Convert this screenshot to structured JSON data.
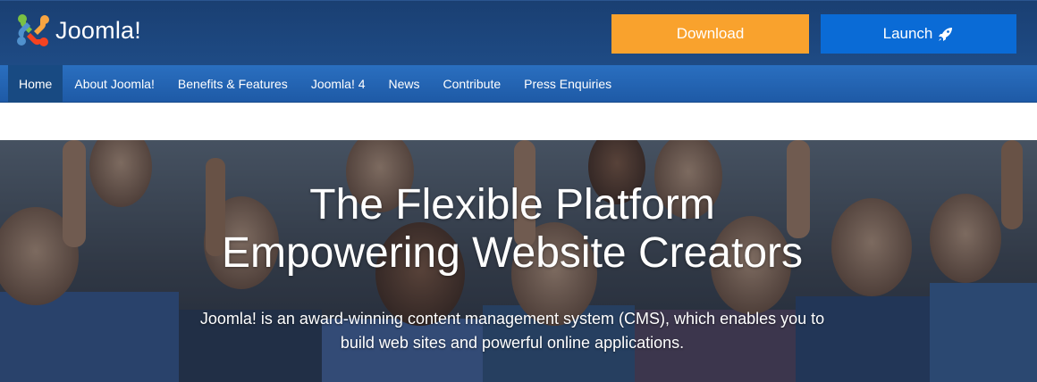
{
  "header": {
    "logo_text": "Joomla!",
    "download_label": "Download",
    "launch_label": "Launch",
    "colors": {
      "download": "#f9a22d",
      "launch": "#0a6bd6",
      "header_bg": "#1e4b85"
    }
  },
  "nav": {
    "items": [
      {
        "label": "Home",
        "active": true
      },
      {
        "label": "About Joomla!"
      },
      {
        "label": "Benefits & Features"
      },
      {
        "label": "Joomla! 4"
      },
      {
        "label": "News"
      },
      {
        "label": "Contribute"
      },
      {
        "label": "Press Enquiries"
      }
    ]
  },
  "hero": {
    "title_line1": "The Flexible Platform",
    "title_line2": "Empowering Website Creators",
    "subtitle_line1": "Joomla! is an award-winning content management system (CMS), which enables you to",
    "subtitle_line2": "build web sites and powerful online applications."
  },
  "icons": {
    "logo": "joomla-logo-icon",
    "rocket": "rocket-icon"
  }
}
